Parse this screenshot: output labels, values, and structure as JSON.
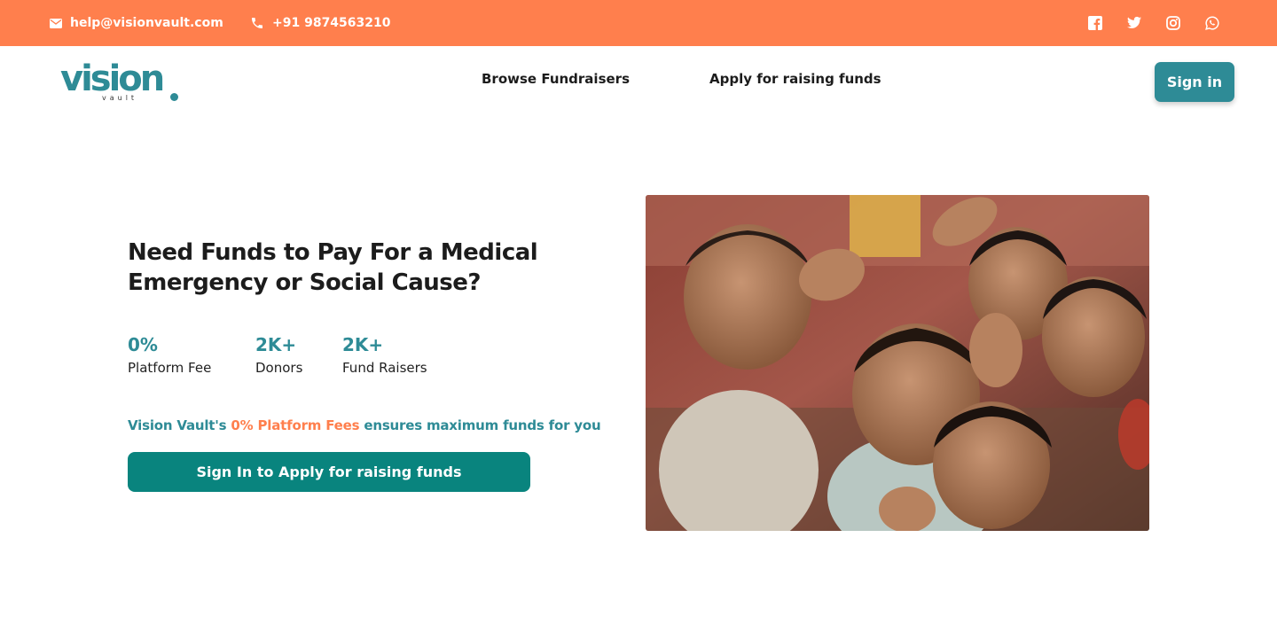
{
  "topbar": {
    "email": "help@visionvault.com",
    "phone": "+91 9874563210",
    "social": [
      "facebook-icon",
      "twitter-icon",
      "instagram-icon",
      "whatsapp-icon"
    ],
    "bg_color": "#ff7f4d"
  },
  "nav": {
    "logo_text": "vision",
    "logo_sub": "vault",
    "links": [
      "Browse Fundraisers",
      "Apply for raising funds"
    ],
    "signin_label": "Sign in"
  },
  "hero": {
    "title": "Need Funds to Pay For a Medical Emergency or Social Cause?",
    "stats": [
      {
        "value": "0%",
        "label": "Platform Fee"
      },
      {
        "value": "2K+",
        "label": "Donors"
      },
      {
        "value": "2K+",
        "label": "Fund Raisers"
      }
    ],
    "tagline_pre": "Vision Vault's ",
    "tagline_highlight": "0% Platform Fees",
    "tagline_post": " ensures maximum funds for you",
    "cta_label": "Sign In to Apply for raising funds"
  },
  "colors": {
    "accent": "#2e8b96",
    "cta": "#09847e",
    "highlight": "#ff7f4d"
  }
}
